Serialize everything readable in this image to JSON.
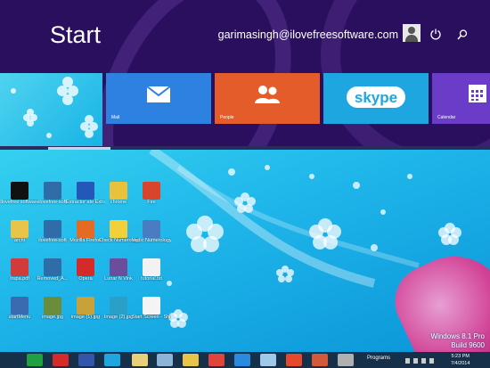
{
  "start": {
    "title": "Start",
    "user_name": "garimasingh@ilovefreesoftware.com"
  },
  "tiles": [
    {
      "label": "Mail",
      "color": "#2d81e0",
      "icon": "mail-icon"
    },
    {
      "label": "People",
      "color": "#e35c29",
      "icon": "people-icon"
    },
    {
      "label": "skype",
      "color": "#1ea6e0",
      "icon": "skype-logo"
    },
    {
      "label": "Calendar",
      "color": "#6a3cc8",
      "icon": "calendar-icon"
    }
  ],
  "desktop_icons": [
    {
      "label": "Ilovefree software",
      "color": "#111"
    },
    {
      "label": "ilovefree-soft",
      "color": "#2f6ca8"
    },
    {
      "label": "Extractor ate Extractor.exe",
      "color": "#2358b8"
    },
    {
      "label": "chrome",
      "color": "#e9c13b"
    },
    {
      "label": "Fire",
      "color": "#d8452a"
    },
    {
      "label": "archi",
      "color": "#e8c44a"
    },
    {
      "label": "ilovefree-soft",
      "color": "#2f6ca8"
    },
    {
      "label": "Mozilla Firefox",
      "color": "#e46b23"
    },
    {
      "label": "Check Numerology",
      "color": "#f2d03b"
    },
    {
      "label": "Vedic Numerology",
      "color": "#4a7cc2"
    },
    {
      "label": "Irupa.pdf",
      "color": "#d23b3b"
    },
    {
      "label": "Removed_A...",
      "color": "#2f6ca8"
    },
    {
      "label": "Opera",
      "color": "#d42a2a"
    },
    {
      "label": "Lunar N Vink",
      "color": "#6b4d9c"
    },
    {
      "label": "tutorial.txt",
      "color": "#f2f2f2"
    },
    {
      "label": "startMenu",
      "color": "#3a6ab0"
    },
    {
      "label": "image.jpg",
      "color": "#6b8c3b"
    },
    {
      "label": "image (1).jpg",
      "color": "#c8a13b"
    },
    {
      "label": "Image (2).jpg",
      "color": "#2aa0c8"
    },
    {
      "label": "Start Screen - Shortcut",
      "color": "#f4f4f4"
    }
  ],
  "watermark": {
    "line1": "Windows 8.1 Pro",
    "line2": "Build 9600"
  },
  "taskbar": {
    "programs_label": "Programs",
    "time": "5:23 PM",
    "date": "7/4/2014",
    "items": [
      {
        "icon": "windows-start-icon",
        "color": "#20a040"
      },
      {
        "icon": "stop-icon",
        "color": "#d42a2a"
      },
      {
        "icon": "app-icon",
        "color": "#3355aa"
      },
      {
        "icon": "desktop-icon",
        "color": "#1ea6e0"
      },
      {
        "icon": "app-icon",
        "color": "#e8d07a"
      },
      {
        "icon": "chart-icon",
        "color": "#8cb4d8"
      },
      {
        "icon": "folder-icon",
        "color": "#e8c44a"
      },
      {
        "icon": "chrome-icon",
        "color": "#e0443a"
      },
      {
        "icon": "ie-icon",
        "color": "#2a8ae0"
      },
      {
        "icon": "pen-icon",
        "color": "#a0c8e8"
      },
      {
        "icon": "store-icon",
        "color": "#e44a2a"
      },
      {
        "icon": "paint-icon",
        "color": "#d05a3a"
      },
      {
        "icon": "scan-icon",
        "color": "#b0b0b0"
      },
      {
        "icon": "file-icon",
        "color": "#cfcfcf"
      },
      {
        "icon": "settings-icon",
        "color": "#5a3cb0"
      }
    ]
  }
}
